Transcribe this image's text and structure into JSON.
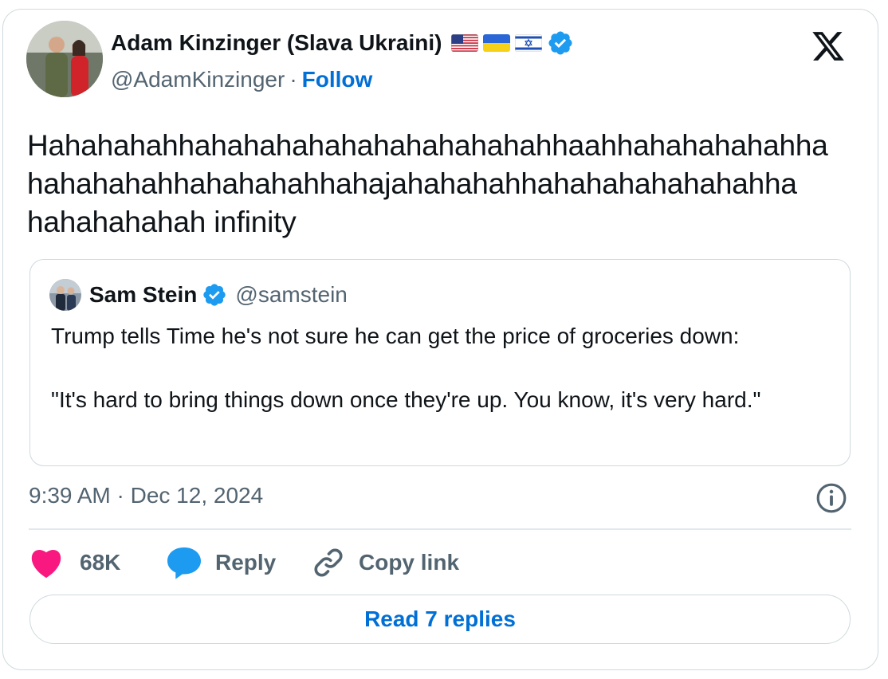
{
  "author": {
    "name": "Adam Kinzinger (Slava Ukraini)",
    "handle": "@AdamKinzinger",
    "separator": "·",
    "follow_label": "Follow",
    "flags": [
      "us-flag-icon",
      "ukraine-flag-icon",
      "israel-flag-icon"
    ],
    "verified_icon": "verified-badge-icon"
  },
  "brand_icon": "x-logo-icon",
  "tweet": {
    "lines": [
      "Hahahahahhahahahahahahahahahahahhaahhahahahahahha",
      "hahahahahhahahahahhahajahahahahhahahahahahahahha",
      "hahahahahah infinity"
    ]
  },
  "quote": {
    "name": "Sam Stein",
    "handle": "@samstein",
    "text_line1": "Trump tells Time he's not sure he can get the price of groceries down:",
    "text_line2": "\"It's hard to bring things down once they're up. You know, it's very hard.\""
  },
  "timestamp": "9:39 AM · Dec 12, 2024",
  "actions": {
    "likes": "68K",
    "reply_label": "Reply",
    "copy_label": "Copy link"
  },
  "read_replies_label": "Read 7 replies",
  "colors": {
    "accent": "#006fd6",
    "verified": "#1d9bf0",
    "like": "#f91880",
    "secondary_text": "#536471",
    "border": "#cfd9de"
  }
}
